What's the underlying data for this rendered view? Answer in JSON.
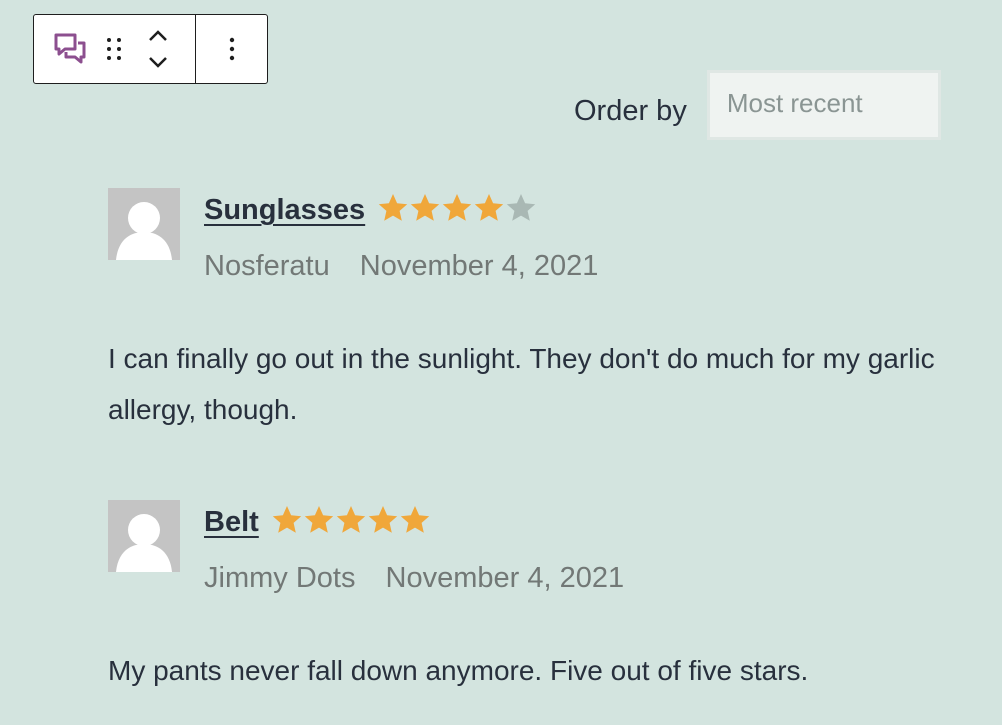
{
  "toolbar": {
    "block_icon": "reviews-block-icon",
    "drag_icon": "drag-handle-icon",
    "move_up_icon": "chevron-up-icon",
    "move_down_icon": "chevron-down-icon",
    "more_icon": "more-vertical-icon"
  },
  "order_by": {
    "label": "Order by",
    "selected": "Most recent"
  },
  "colors": {
    "background": "#d3e4df",
    "star_filled": "#f0a73a",
    "star_empty": "#a9b8b4",
    "block_icon": "#8c4f8f"
  },
  "reviews": [
    {
      "product": "Sunglasses",
      "rating": 4,
      "rating_max": 5,
      "author": "Nosferatu",
      "date": "November 4, 2021",
      "text": "I can finally go out in the sunlight. They don't do much for my garlic allergy, though."
    },
    {
      "product": "Belt",
      "rating": 5,
      "rating_max": 5,
      "author": "Jimmy Dots",
      "date": "November 4, 2021",
      "text": "My pants never fall down anymore. Five out of five stars."
    }
  ]
}
